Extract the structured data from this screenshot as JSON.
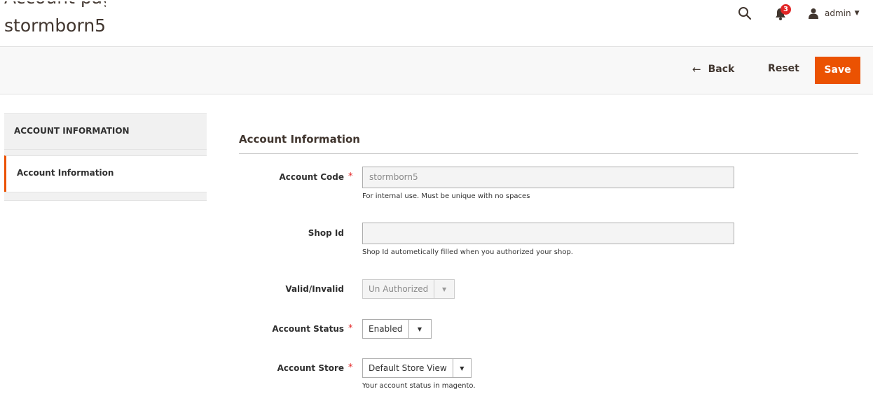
{
  "header": {
    "title": "stormborn5",
    "title_cut_text": "Account page up then press any account. Then it will navigate to you the account",
    "notifications_count": "3",
    "user_name": "admin"
  },
  "actions": {
    "back_label": "Back",
    "reset_label": "Reset",
    "save_label": "Save",
    "accent_color": "#eb5202"
  },
  "sidebar": {
    "heading": "ACCOUNT INFORMATION",
    "items": [
      {
        "label": "Account Information",
        "active": true
      }
    ]
  },
  "form": {
    "section_title": "Account Information",
    "fields": [
      {
        "label": "Account Code",
        "required": true,
        "value": "stormborn5",
        "note": "For internal use. Must be unique with no spaces"
      },
      {
        "label": "Shop Id",
        "required": false,
        "value": "",
        "note": "Shop Id autometically filled when you authorized your shop."
      },
      {
        "label": "Valid/Invalid",
        "required": false,
        "value": "Un Authorized",
        "disabled": true
      },
      {
        "label": "Account Status",
        "required": true,
        "value": "Enabled"
      },
      {
        "label": "Account Store",
        "required": true,
        "value": "Default Store View",
        "note": "Your account status in magento."
      }
    ]
  }
}
